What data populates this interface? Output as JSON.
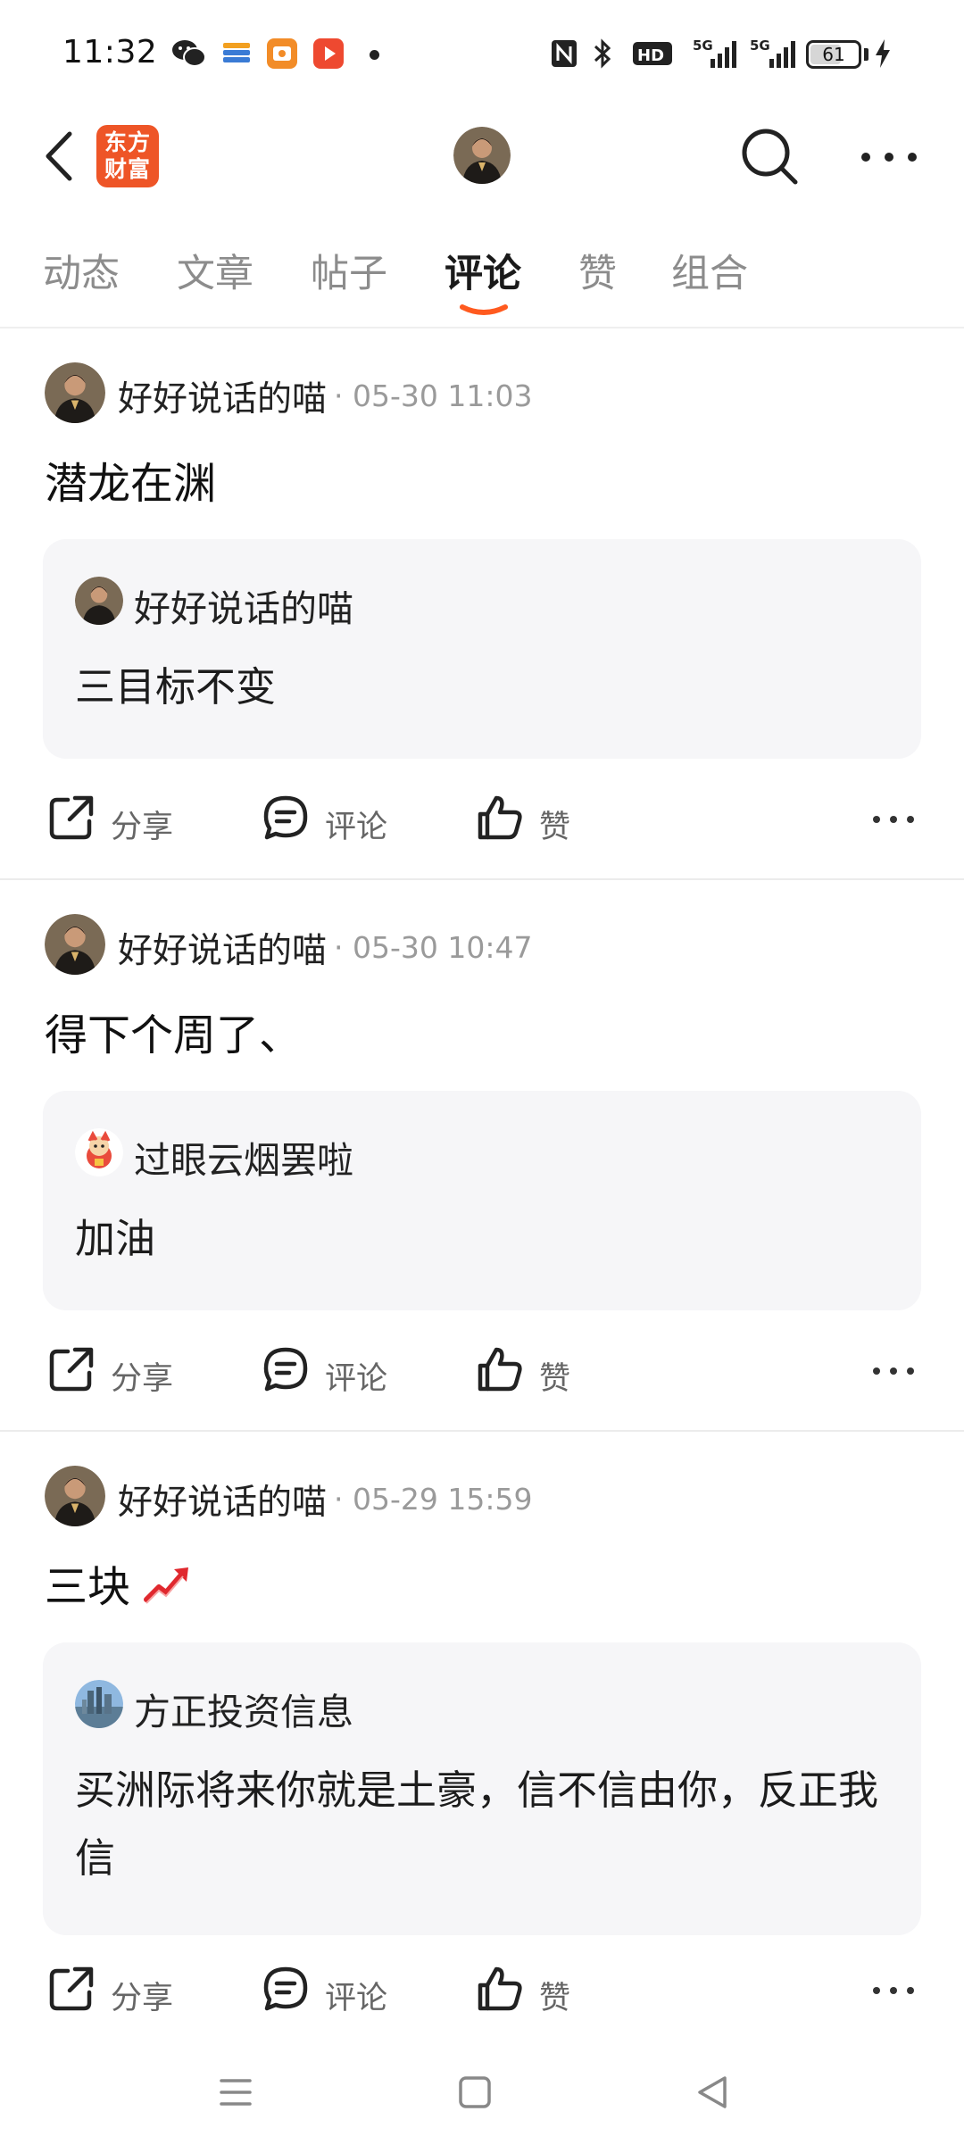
{
  "status_bar": {
    "time": "11:32",
    "battery": "61",
    "battery_level_percent": 61,
    "icons": [
      "wechat-icon",
      "card-app-icon",
      "video-app-icon",
      "play-app-icon",
      "nfc-icon",
      "bluetooth-icon",
      "hd-icon",
      "5g-signal-icon",
      "5g-signal-icon",
      "battery-icon",
      "charging-icon"
    ]
  },
  "header": {
    "logo_line1": "东方",
    "logo_line2": "财富"
  },
  "tabs": [
    {
      "label": "动态",
      "active": false
    },
    {
      "label": "文章",
      "active": false
    },
    {
      "label": "帖子",
      "active": false
    },
    {
      "label": "评论",
      "active": true
    },
    {
      "label": "赞",
      "active": false
    },
    {
      "label": "组合",
      "active": false
    }
  ],
  "colors": {
    "accent": "#ee5527",
    "tab_indicator": "#ff5a1f",
    "quote_bg": "#f6f6f8",
    "trend_red": "#e0282e"
  },
  "posts": [
    {
      "author": "好好说话的喵",
      "time": "· 05-30 11:03",
      "text": "潜龙在渊",
      "quote": {
        "name": "好好说话的喵",
        "text": "三目标不变"
      }
    },
    {
      "author": "好好说话的喵",
      "time": "· 05-30 10:47",
      "text": "得下个周了、",
      "quote": {
        "name": "过眼云烟罢啦",
        "text": "加油"
      }
    },
    {
      "author": "好好说话的喵",
      "time": "· 05-29 15:59",
      "text": "三块",
      "text_emoji": "chart-increasing-icon",
      "quote": {
        "name": "方正投资信息",
        "text": "买洲际将来你就是土豪，信不信由你，反正我信"
      }
    }
  ],
  "actions": {
    "share": "分享",
    "comment": "评论",
    "like": "赞"
  }
}
